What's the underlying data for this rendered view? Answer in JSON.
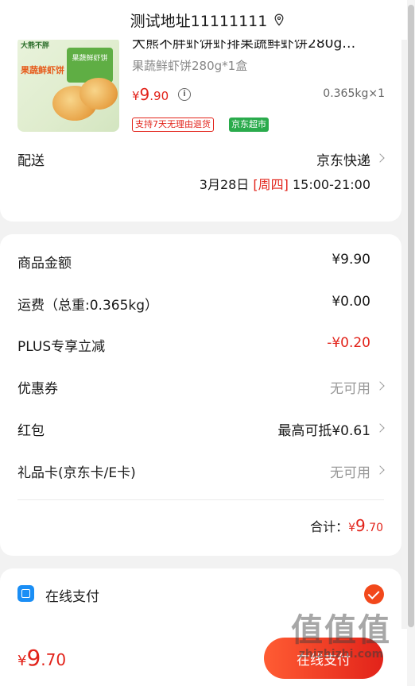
{
  "header": {
    "address": "测试地址11111111",
    "pin_icon": "location-pin-icon"
  },
  "product": {
    "title": "大熊不胖虾饼虾排果蔬鲜虾饼280g…",
    "spec": "果蔬鲜虾饼280g*1盒",
    "price_currency": "¥",
    "price_int": "9",
    "price_dec": ".90",
    "weight_qty": "0.365kg×1",
    "tags": {
      "return_policy": "支持7天无理由退货",
      "store": "京东超市"
    },
    "image": {
      "brand": "大熊不胖",
      "title": "果蔬鲜虾饼",
      "box_label": "果蔬鲜虾饼"
    }
  },
  "delivery": {
    "label": "配送",
    "method": "京东快递",
    "date": "3月28日",
    "weekday": "[周四]",
    "time": "15:00-21:00"
  },
  "summary": {
    "goods_label": "商品金额",
    "goods_value": "¥9.90",
    "shipping_label": "运费（总重:0.365kg）",
    "shipping_value": "¥0.00",
    "plus_label": "PLUS专享立减",
    "plus_value": "-¥0.20",
    "coupon_label": "优惠券",
    "coupon_value": "无可用",
    "redpacket_label": "红包",
    "redpacket_value": "最高可抵¥0.61",
    "giftcard_label": "礼品卡(京东卡/E卡)",
    "giftcard_value": "无可用",
    "subtotal_label": "合计：",
    "subtotal_currency": "¥",
    "subtotal_int": "9",
    "subtotal_dec": ".70"
  },
  "payment": {
    "label": "在线支付",
    "selected": true
  },
  "footer": {
    "price_currency": "¥",
    "price_int": "9",
    "price_dec": ".70",
    "submit_label": "在线支付"
  },
  "watermark": {
    "logo": "值值值",
    "url": "zhizhizhi.com"
  },
  "colors": {
    "accent_red": "#e2231a",
    "green_tag": "#2aab4c",
    "pay_blue": "#1a8ef5"
  }
}
